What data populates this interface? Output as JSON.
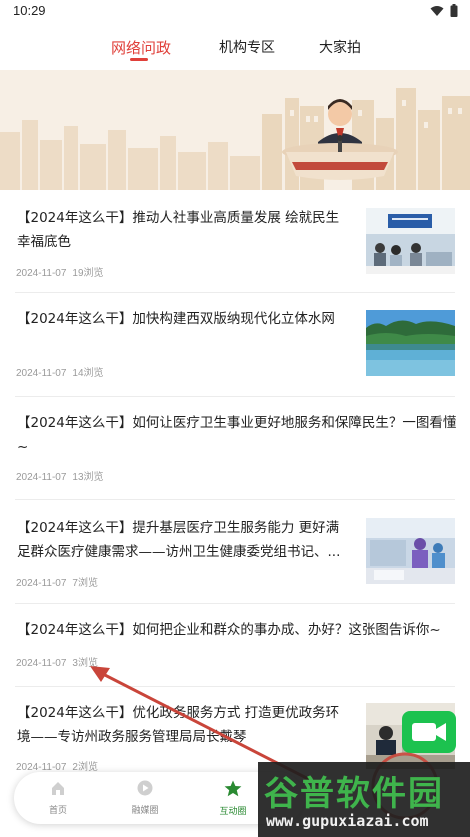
{
  "status_bar": {
    "time": "10:29"
  },
  "top_tabs": [
    {
      "label": "网络问政",
      "active": true
    },
    {
      "label": "机构专区",
      "active": false
    },
    {
      "label": "大家拍",
      "active": false
    }
  ],
  "articles": [
    {
      "title": "【2024年这么干】推动人社事业高质量发展 绘就民生幸福底色",
      "date": "2024-11-07",
      "views": "19浏览",
      "thumb": "office-meeting"
    },
    {
      "title": "【2024年这么干】加快构建西双版纳现代化立体水网",
      "date": "2024-11-07",
      "views": "14浏览",
      "thumb": "lake-landscape"
    },
    {
      "title": "【2024年这么干】如何让医疗卫生事业更好地服务和保障民生？一图看懂~",
      "date": "2024-11-07",
      "views": "13浏览",
      "thumb": ""
    },
    {
      "title": "【2024年这么干】提升基层医疗卫生服务能力 更好满足群众医疗健康需求——访州卫生健康委党组书记、...",
      "date": "2024-11-07",
      "views": "7浏览",
      "thumb": "hospital-ward"
    },
    {
      "title": "【2024年这么干】如何把企业和群众的事办成、办好？这张图告诉你~",
      "date": "2024-11-07",
      "views": "3浏览",
      "thumb": ""
    },
    {
      "title": "【2024年这么干】优化政务服务方式 打造更优政务环境——专访州政务服务管理局局长戴琴",
      "date": "2024-11-07",
      "views": "2浏览",
      "thumb": "service-hall"
    }
  ],
  "bottom_tabs": [
    {
      "label": "首页",
      "icon": "home-icon"
    },
    {
      "label": "融媒圈",
      "icon": "play-icon"
    },
    {
      "label": "互动圈",
      "icon": "star-icon",
      "active": true
    }
  ],
  "watermark": {
    "title": "谷普软件园",
    "url": "www.gupuxiazai.com"
  },
  "colors": {
    "accent": "#e0403a",
    "active_tab_green": "#2a8a32",
    "float_button": "#1cc24f"
  }
}
